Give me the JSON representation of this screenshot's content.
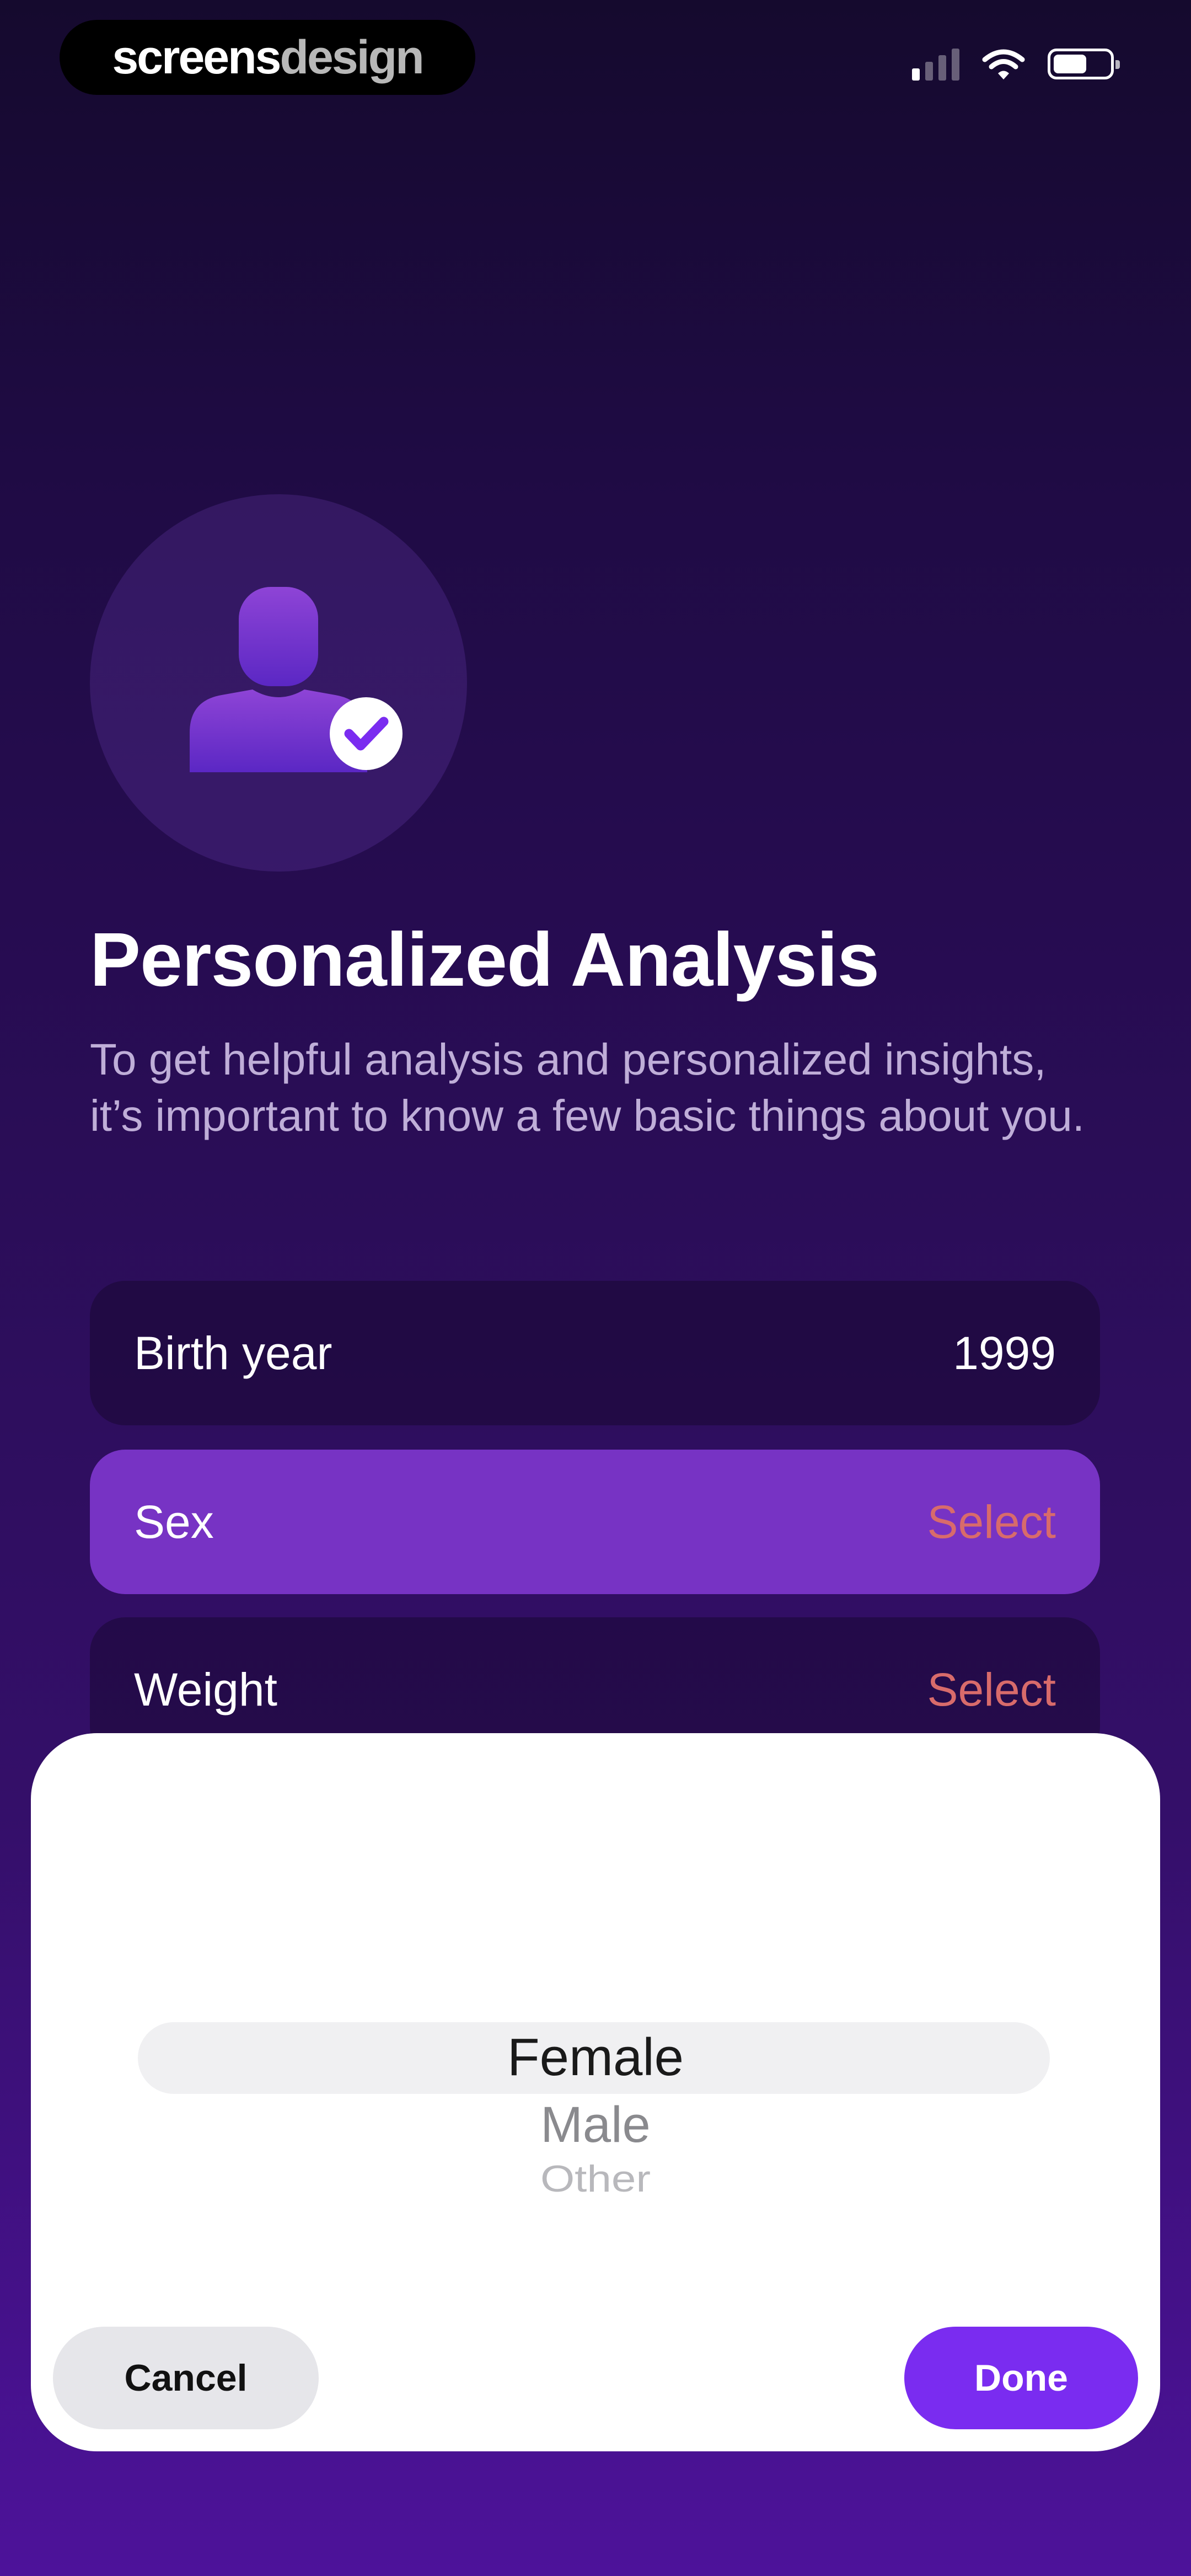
{
  "status_bar": {
    "brand_part1": "screens",
    "brand_part2": "design",
    "signal_bars_active": 1,
    "signal_bars_total": 4,
    "battery_level": 0.6
  },
  "header": {
    "title": "Personalized Analysis",
    "subtitle": "To get helpful analysis and personalized insights, it’s important to know a few basic things about you."
  },
  "fields": [
    {
      "label": "Birth year",
      "value": "1999"
    },
    {
      "label": "Sex",
      "value": "Select"
    },
    {
      "label": "Weight",
      "value": "Select"
    }
  ],
  "picker": {
    "options": [
      "Female",
      "Male",
      "Other"
    ],
    "selected": "Female"
  },
  "sheet": {
    "cancel_label": "Cancel",
    "done_label": "Done"
  },
  "colors": {
    "accent": "#7a2cf0",
    "selected_field": "#7733c4",
    "placeholder_text": "#d86b6b",
    "background_top": "#150a2e",
    "background_bottom": "#4d129a"
  }
}
